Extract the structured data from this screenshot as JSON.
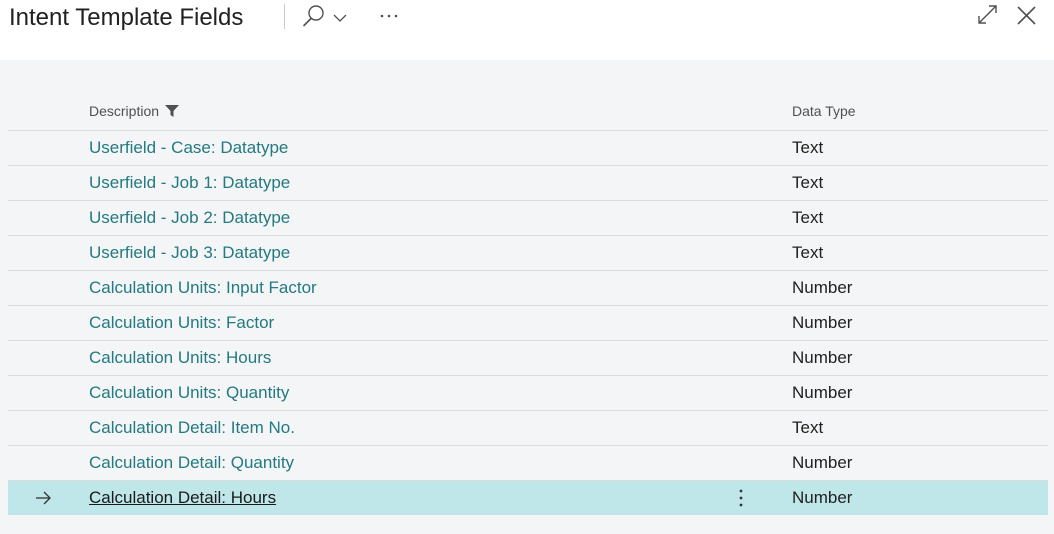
{
  "page": {
    "title": "Intent Template Fields"
  },
  "columns": {
    "description": "Description",
    "data_type": "Data Type"
  },
  "rows": [
    {
      "description": "Userfield - Case: Datatype",
      "data_type": "Text"
    },
    {
      "description": "Userfield - Job 1: Datatype",
      "data_type": "Text"
    },
    {
      "description": "Userfield - Job 2: Datatype",
      "data_type": "Text"
    },
    {
      "description": "Userfield - Job 3: Datatype",
      "data_type": "Text"
    },
    {
      "description": "Calculation Units: Input Factor",
      "data_type": "Number"
    },
    {
      "description": "Calculation Units: Factor",
      "data_type": "Number"
    },
    {
      "description": "Calculation Units: Hours",
      "data_type": "Number"
    },
    {
      "description": "Calculation Units: Quantity",
      "data_type": "Number"
    },
    {
      "description": "Calculation Detail: Item No.",
      "data_type": "Text"
    },
    {
      "description": "Calculation Detail: Quantity",
      "data_type": "Number"
    },
    {
      "description": "Calculation Detail: Hours",
      "data_type": "Number"
    }
  ],
  "selected_row": 10,
  "colors": {
    "link": "#237a80",
    "selected_row": "#bfe7ea",
    "content_background": "#f4f5f6"
  },
  "icons": {
    "search": "search-icon",
    "search_options": "chevron-down-icon",
    "more": "more-options-icon",
    "filter": "filter-icon",
    "expand": "expand-icon",
    "close": "close-icon",
    "current_row": "arrow-right-icon",
    "row_actions": "kebab-menu-icon"
  }
}
